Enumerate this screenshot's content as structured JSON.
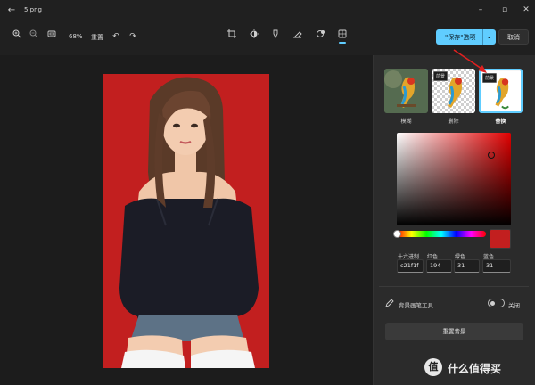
{
  "window": {
    "title": "5.png",
    "back_icon": "back-arrow-icon",
    "controls": [
      "minimize-icon",
      "maximize-icon",
      "close-icon"
    ]
  },
  "toolbar": {
    "zoom_in_icon": "zoom-in-icon",
    "zoom_out_icon": "zoom-out-icon",
    "fit_icon": "fit-to-window-icon",
    "zoom_level": "68%",
    "reset_label": "重置",
    "undo_icon": "undo-icon",
    "redo_icon": "redo-icon",
    "tools": [
      "crop-icon",
      "adjust-icon",
      "markup-icon",
      "erase-icon",
      "filter-icon",
      "background-icon"
    ],
    "save_label": "\"保存\"选项",
    "save_caret": "⌄",
    "cancel_label": "取消",
    "accent": "#60cdff"
  },
  "background_panel": {
    "options": [
      {
        "label": "模糊",
        "badge": ""
      },
      {
        "label": "删除",
        "badge": "前景"
      },
      {
        "label": "替换",
        "badge": "前景",
        "selected": true
      }
    ],
    "color_picker": {
      "hex_label": "十六进制",
      "red_label": "红色",
      "green_label": "绿色",
      "blue_label": "蓝色",
      "hex_value": "c21f1f",
      "red_value": "194",
      "green_value": "31",
      "blue_value": "31",
      "current_color": "#c21f1f"
    },
    "brush_tool_label": "背景画笔工具",
    "brush_toggle_label": "关闭",
    "reset_background_label": "重置背景"
  },
  "watermark": {
    "logo": "值",
    "text": "什么值得买"
  }
}
